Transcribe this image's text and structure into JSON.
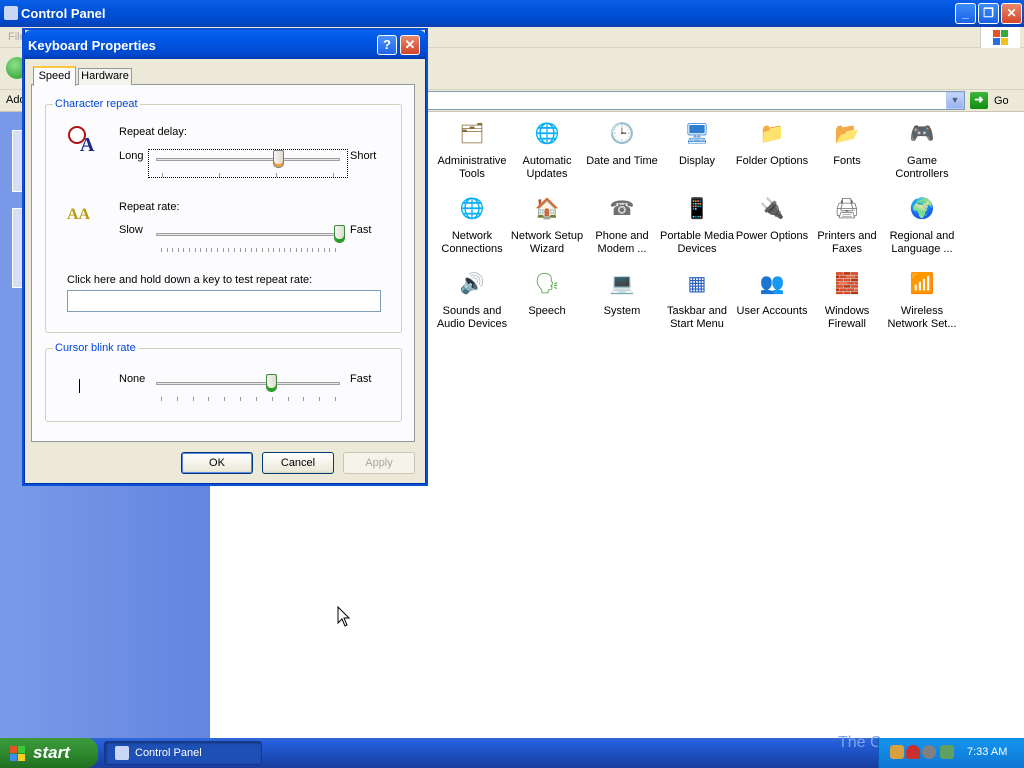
{
  "window": {
    "title": "Control Panel"
  },
  "menu": {
    "file": "File"
  },
  "address": {
    "label": "Address",
    "go_label": "Go"
  },
  "icons": [
    {
      "label": "Administrative Tools",
      "glyph": "🗂",
      "color": "#8a6a3a"
    },
    {
      "label": "Automatic Updates",
      "glyph": "🌐",
      "color": "#2c6fd8"
    },
    {
      "label": "Date and Time",
      "glyph": "🕒",
      "color": "#5a7fb0"
    },
    {
      "label": "Display",
      "glyph": "🖥",
      "color": "#2f7fd0"
    },
    {
      "label": "Folder Options",
      "glyph": "📁",
      "color": "#d8b030"
    },
    {
      "label": "Fonts",
      "glyph": "📂",
      "color": "#d8c030"
    },
    {
      "label": "Game Controllers",
      "glyph": "🎮",
      "color": "#6a6ab8"
    },
    {
      "label": "Network Connections",
      "glyph": "🌐",
      "color": "#2a8a5a"
    },
    {
      "label": "Network Setup Wizard",
      "glyph": "🏠",
      "color": "#c05030"
    },
    {
      "label": "Phone and Modem ...",
      "glyph": "☎",
      "color": "#707070"
    },
    {
      "label": "Portable Media Devices",
      "glyph": "📱",
      "color": "#808060"
    },
    {
      "label": "Power Options",
      "glyph": "🔌",
      "color": "#909090"
    },
    {
      "label": "Printers and Faxes",
      "glyph": "🖨",
      "color": "#707070"
    },
    {
      "label": "Regional and Language ...",
      "glyph": "🌍",
      "color": "#2a7ac0"
    },
    {
      "label": "Sounds and Audio Devices",
      "glyph": "🔊",
      "color": "#6a6a6a"
    },
    {
      "label": "Speech",
      "glyph": "🗣",
      "color": "#4a9a3a"
    },
    {
      "label": "System",
      "glyph": "💻",
      "color": "#4a70b0"
    },
    {
      "label": "Taskbar and Start Menu",
      "glyph": "▦",
      "color": "#2a60c0"
    },
    {
      "label": "User Accounts",
      "glyph": "👥",
      "color": "#c07030"
    },
    {
      "label": "Windows Firewall",
      "glyph": "🧱",
      "color": "#c04020"
    },
    {
      "label": "Wireless Network Set...",
      "glyph": "📶",
      "color": "#60a040"
    }
  ],
  "dialog": {
    "title": "Keyboard Properties",
    "tabs": {
      "speed": "Speed",
      "hardware": "Hardware"
    },
    "char_repeat": {
      "title": "Character repeat",
      "delay_label": "Repeat delay:",
      "delay_low": "Long",
      "delay_high": "Short",
      "delay_value": 0.67,
      "rate_label": "Repeat rate:",
      "rate_low": "Slow",
      "rate_high": "Fast",
      "rate_value": 1.0,
      "test_label": "Click here and hold down a key to test repeat rate:",
      "test_value": ""
    },
    "cursor_blink": {
      "title": "Cursor blink rate",
      "low": "None",
      "high": "Fast",
      "value": 0.63
    },
    "buttons": {
      "ok": "OK",
      "cancel": "Cancel",
      "apply": "Apply"
    }
  },
  "taskbar": {
    "start_label": "start",
    "task_label": "Control Panel",
    "clock": "7:33 AM",
    "watermark": "The C"
  }
}
